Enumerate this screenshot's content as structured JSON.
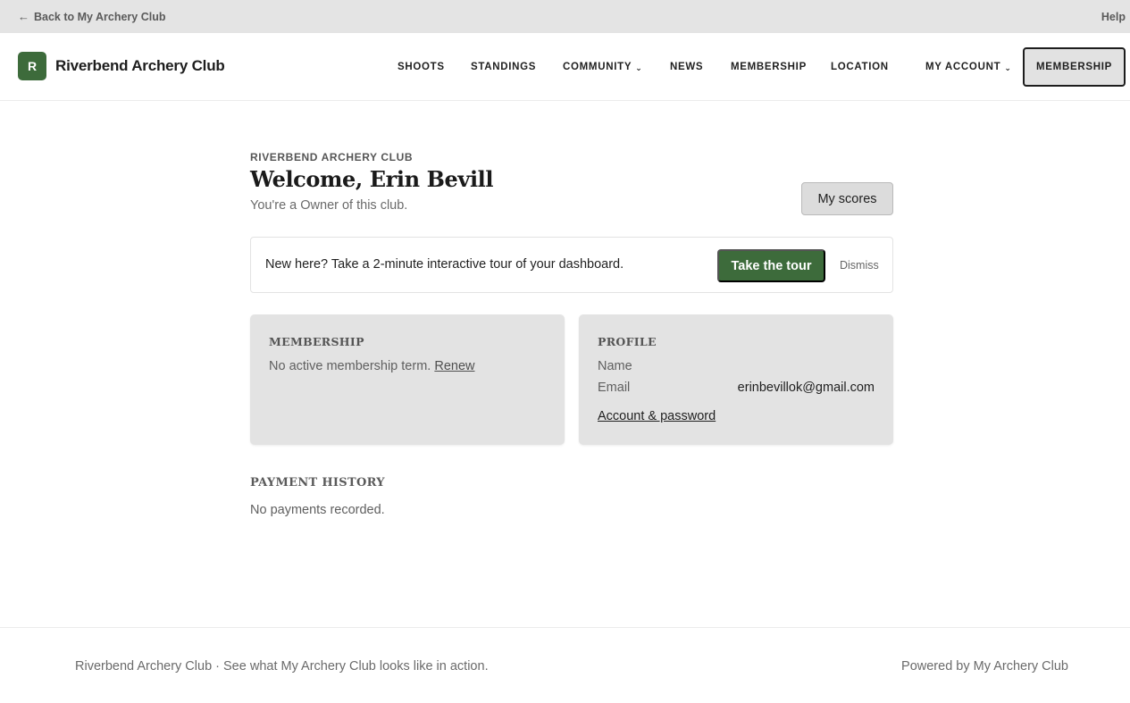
{
  "topbar": {
    "back_arrow": "←",
    "back_label": "Back to My Archery Club",
    "help_label": "Help"
  },
  "brand": {
    "logo_letter": "R",
    "name": "Riverbend Archery Club",
    "accent_color": "#3d6b3b"
  },
  "nav": {
    "shoots": "SHOOTS",
    "standings": "STANDINGS",
    "community": "COMMUNITY",
    "news": "NEWS",
    "membership": "MEMBERSHIP",
    "location": "LOCATION",
    "my_account": "MY ACCOUNT",
    "caret": "⌄",
    "cta_membership": "MEMBERSHIP"
  },
  "main": {
    "eyebrow": "RIVERBEND ARCHERY CLUB",
    "welcome": "Welcome, Erin Bevill",
    "role_text": "You're a Owner of this club.",
    "scores_button": "My scores"
  },
  "tour": {
    "message": "New here? Take a 2-minute interactive tour of your dashboard.",
    "cta": "Take the tour",
    "dismiss": "Dismiss"
  },
  "membership_card": {
    "title": "MEMBERSHIP",
    "text": "No active membership term.",
    "renew_link": "Renew"
  },
  "profile_card": {
    "title": "PROFILE",
    "name_label": "Name",
    "name_value": "",
    "email_label": "Email",
    "email_value": "erinbevillok@gmail.com",
    "account_link": "Account & password"
  },
  "payments": {
    "title": "PAYMENT HISTORY",
    "empty": "No payments recorded."
  },
  "footer": {
    "left": "Riverbend Archery Club · See what My Archery Club looks like in action.",
    "right": "Powered by My Archery Club"
  }
}
